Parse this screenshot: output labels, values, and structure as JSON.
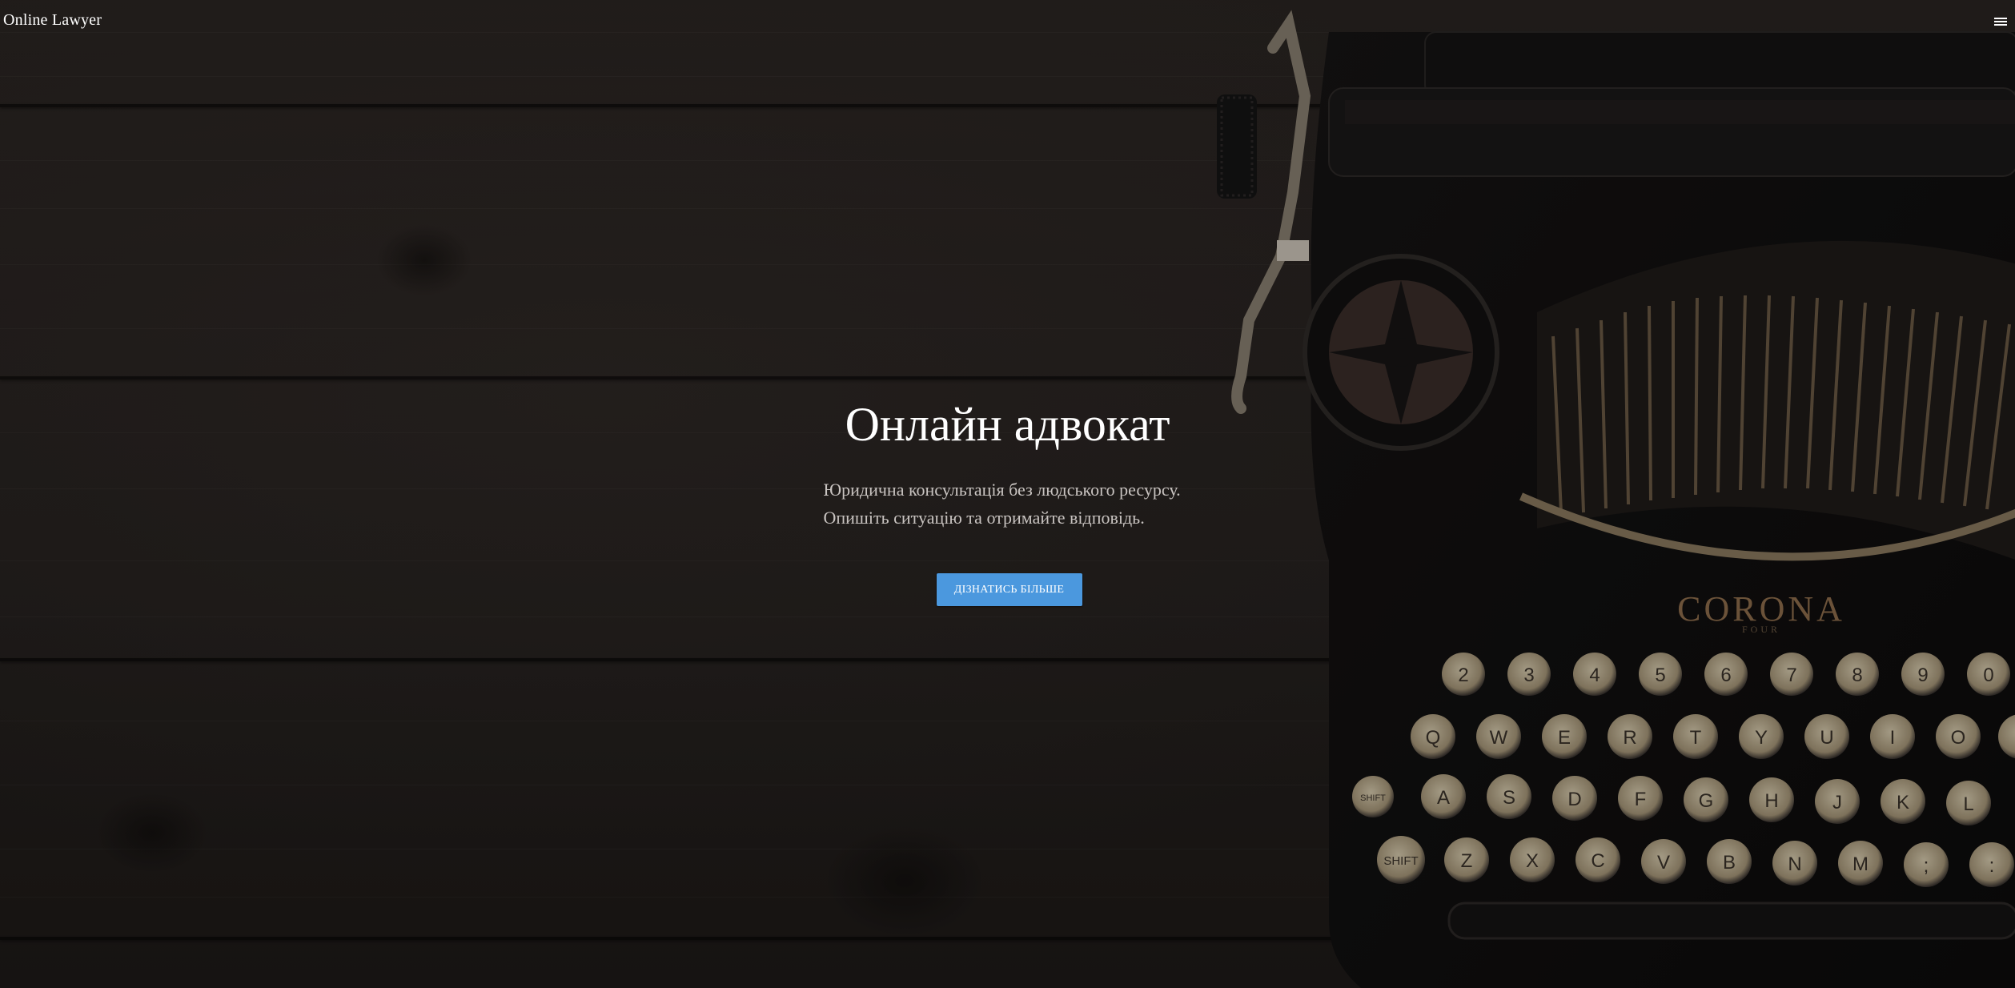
{
  "navbar": {
    "brand": "Online Lawyer",
    "menu_icon": "hamburger-menu-icon"
  },
  "hero": {
    "title": "Онлайн адвокат",
    "subtitle_line1": "Юридична консультація без людського ресурсу.",
    "subtitle_line2": "Опишіть ситуацію та отримайте відповідь.",
    "cta_label": "ДІЗНАТИСЬ БІЛЬШЕ"
  },
  "background": {
    "image": "typewriter-on-wood-photo",
    "typewriter_brand": "CORONA",
    "typewriter_model": "FOUR"
  },
  "colors": {
    "accent": "#4b98de",
    "title": "#ffffff",
    "subtitle": "#c9c4c1",
    "wood": "#272220"
  }
}
